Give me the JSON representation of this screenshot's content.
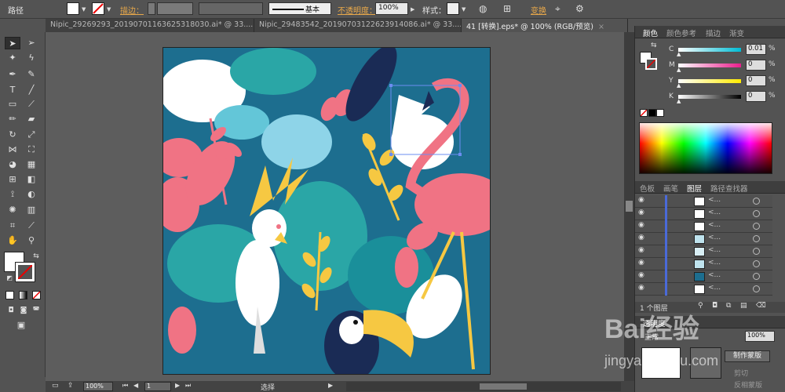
{
  "control_bar": {
    "object_type": "路径",
    "stroke_label": "描边：",
    "stroke_profile": "基本",
    "opacity_label": "不透明度：",
    "opacity_value": "100%",
    "style_label": "样式：",
    "transform_label": "变换"
  },
  "document_tabs": [
    {
      "title": "Nipic_29269293_20190701163625318030.ai* @ 33....",
      "close": "×"
    },
    {
      "title": "Nipic_29483542_20190703122623914086.ai* @ 33....",
      "close": "×"
    },
    {
      "title": "41 [转换].eps* @ 100% (RGB/预览)",
      "close": "×"
    }
  ],
  "color_panel": {
    "tabs": [
      "颜色",
      "颜色参考",
      "描边",
      "渐变"
    ],
    "channels": [
      {
        "letter": "C",
        "value": "0.01",
        "unit": "%",
        "color": "#00bcd4"
      },
      {
        "letter": "M",
        "value": "0",
        "unit": "%",
        "color": "#e91e8c"
      },
      {
        "letter": "Y",
        "value": "0",
        "unit": "%",
        "color": "#ffeb00"
      },
      {
        "letter": "K",
        "value": "0",
        "unit": "%",
        "color": "#000000"
      }
    ]
  },
  "layers_panel": {
    "tabs": [
      "色板",
      "画笔",
      "图层",
      "路径查找器"
    ],
    "row_label": "<...",
    "row_count": 8,
    "footer": "1 个图层"
  },
  "transparency_panel": {
    "tab": "透明度",
    "mode": "正常",
    "opacity": "100%",
    "make_mask": "制作蒙版",
    "clip": "剪切",
    "invert_mask": "反相蒙版"
  },
  "status_bar": {
    "zoom": "100%",
    "page": "1",
    "tool_name": "选择"
  },
  "watermark": {
    "brand": "Bai经验",
    "url": "jingyan.baidu.com"
  },
  "colors": {
    "artboard_bg": "#1d6e8f",
    "pink": "#f07384",
    "yellow": "#f6c842",
    "teal": "#2aa6a6"
  }
}
